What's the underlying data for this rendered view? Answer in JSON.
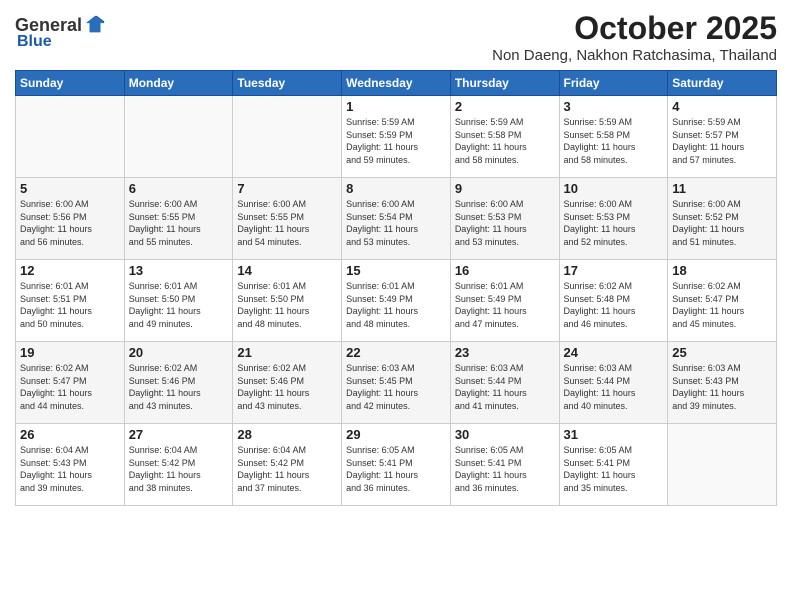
{
  "header": {
    "logo_general": "General",
    "logo_blue": "Blue",
    "month": "October 2025",
    "location": "Non Daeng, Nakhon Ratchasima, Thailand"
  },
  "days_of_week": [
    "Sunday",
    "Monday",
    "Tuesday",
    "Wednesday",
    "Thursday",
    "Friday",
    "Saturday"
  ],
  "weeks": [
    [
      {
        "day": "",
        "info": ""
      },
      {
        "day": "",
        "info": ""
      },
      {
        "day": "",
        "info": ""
      },
      {
        "day": "1",
        "info": "Sunrise: 5:59 AM\nSunset: 5:59 PM\nDaylight: 11 hours\nand 59 minutes."
      },
      {
        "day": "2",
        "info": "Sunrise: 5:59 AM\nSunset: 5:58 PM\nDaylight: 11 hours\nand 58 minutes."
      },
      {
        "day": "3",
        "info": "Sunrise: 5:59 AM\nSunset: 5:58 PM\nDaylight: 11 hours\nand 58 minutes."
      },
      {
        "day": "4",
        "info": "Sunrise: 5:59 AM\nSunset: 5:57 PM\nDaylight: 11 hours\nand 57 minutes."
      }
    ],
    [
      {
        "day": "5",
        "info": "Sunrise: 6:00 AM\nSunset: 5:56 PM\nDaylight: 11 hours\nand 56 minutes."
      },
      {
        "day": "6",
        "info": "Sunrise: 6:00 AM\nSunset: 5:55 PM\nDaylight: 11 hours\nand 55 minutes."
      },
      {
        "day": "7",
        "info": "Sunrise: 6:00 AM\nSunset: 5:55 PM\nDaylight: 11 hours\nand 54 minutes."
      },
      {
        "day": "8",
        "info": "Sunrise: 6:00 AM\nSunset: 5:54 PM\nDaylight: 11 hours\nand 53 minutes."
      },
      {
        "day": "9",
        "info": "Sunrise: 6:00 AM\nSunset: 5:53 PM\nDaylight: 11 hours\nand 53 minutes."
      },
      {
        "day": "10",
        "info": "Sunrise: 6:00 AM\nSunset: 5:53 PM\nDaylight: 11 hours\nand 52 minutes."
      },
      {
        "day": "11",
        "info": "Sunrise: 6:00 AM\nSunset: 5:52 PM\nDaylight: 11 hours\nand 51 minutes."
      }
    ],
    [
      {
        "day": "12",
        "info": "Sunrise: 6:01 AM\nSunset: 5:51 PM\nDaylight: 11 hours\nand 50 minutes."
      },
      {
        "day": "13",
        "info": "Sunrise: 6:01 AM\nSunset: 5:50 PM\nDaylight: 11 hours\nand 49 minutes."
      },
      {
        "day": "14",
        "info": "Sunrise: 6:01 AM\nSunset: 5:50 PM\nDaylight: 11 hours\nand 48 minutes."
      },
      {
        "day": "15",
        "info": "Sunrise: 6:01 AM\nSunset: 5:49 PM\nDaylight: 11 hours\nand 48 minutes."
      },
      {
        "day": "16",
        "info": "Sunrise: 6:01 AM\nSunset: 5:49 PM\nDaylight: 11 hours\nand 47 minutes."
      },
      {
        "day": "17",
        "info": "Sunrise: 6:02 AM\nSunset: 5:48 PM\nDaylight: 11 hours\nand 46 minutes."
      },
      {
        "day": "18",
        "info": "Sunrise: 6:02 AM\nSunset: 5:47 PM\nDaylight: 11 hours\nand 45 minutes."
      }
    ],
    [
      {
        "day": "19",
        "info": "Sunrise: 6:02 AM\nSunset: 5:47 PM\nDaylight: 11 hours\nand 44 minutes."
      },
      {
        "day": "20",
        "info": "Sunrise: 6:02 AM\nSunset: 5:46 PM\nDaylight: 11 hours\nand 43 minutes."
      },
      {
        "day": "21",
        "info": "Sunrise: 6:02 AM\nSunset: 5:46 PM\nDaylight: 11 hours\nand 43 minutes."
      },
      {
        "day": "22",
        "info": "Sunrise: 6:03 AM\nSunset: 5:45 PM\nDaylight: 11 hours\nand 42 minutes."
      },
      {
        "day": "23",
        "info": "Sunrise: 6:03 AM\nSunset: 5:44 PM\nDaylight: 11 hours\nand 41 minutes."
      },
      {
        "day": "24",
        "info": "Sunrise: 6:03 AM\nSunset: 5:44 PM\nDaylight: 11 hours\nand 40 minutes."
      },
      {
        "day": "25",
        "info": "Sunrise: 6:03 AM\nSunset: 5:43 PM\nDaylight: 11 hours\nand 39 minutes."
      }
    ],
    [
      {
        "day": "26",
        "info": "Sunrise: 6:04 AM\nSunset: 5:43 PM\nDaylight: 11 hours\nand 39 minutes."
      },
      {
        "day": "27",
        "info": "Sunrise: 6:04 AM\nSunset: 5:42 PM\nDaylight: 11 hours\nand 38 minutes."
      },
      {
        "day": "28",
        "info": "Sunrise: 6:04 AM\nSunset: 5:42 PM\nDaylight: 11 hours\nand 37 minutes."
      },
      {
        "day": "29",
        "info": "Sunrise: 6:05 AM\nSunset: 5:41 PM\nDaylight: 11 hours\nand 36 minutes."
      },
      {
        "day": "30",
        "info": "Sunrise: 6:05 AM\nSunset: 5:41 PM\nDaylight: 11 hours\nand 36 minutes."
      },
      {
        "day": "31",
        "info": "Sunrise: 6:05 AM\nSunset: 5:41 PM\nDaylight: 11 hours\nand 35 minutes."
      },
      {
        "day": "",
        "info": ""
      }
    ]
  ]
}
